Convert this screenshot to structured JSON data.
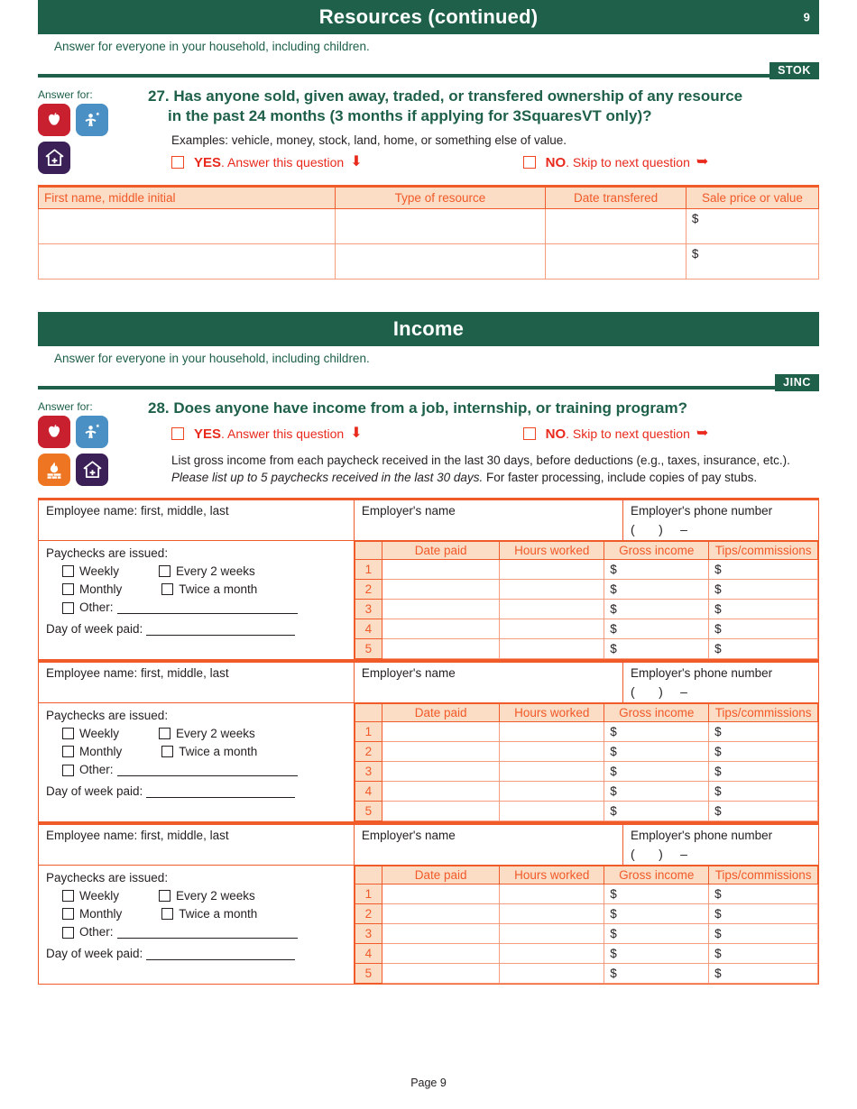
{
  "document": {
    "footer": "Page 9"
  },
  "sections": [
    {
      "banner_title": "Resources (continued)",
      "banner_page": "9",
      "banner_subtitle": "Answer for everyone in your household, including children.",
      "code_badge": "STOK"
    },
    {
      "banner_title": "Income",
      "banner_page": "",
      "banner_subtitle": "Answer for everyone in your household, including children.",
      "code_badge": "JINC"
    }
  ],
  "answer_for_label": "Answer for:",
  "icons": {
    "apple": "apple-icon",
    "child": "child-star-icon",
    "fuel": "fuel-flame-icon",
    "health": "house-health-icon"
  },
  "yesno": {
    "yes_word": "YES",
    "yes_text": ". Answer this question",
    "yes_arrow": "⬇",
    "no_word": "NO",
    "no_text": ". Skip to next question",
    "no_arrow": "➥"
  },
  "q27": {
    "number": "27.",
    "line1": "Has anyone sold, given away, traded, or transfered ownership of any resource",
    "line2": "in the past 24 months (3 months if applying for 3SquaresVT only)?",
    "examples": "Examples: vehicle, money, stock, land, home, or something else of value.",
    "table": {
      "headers": [
        "First name, middle initial",
        "Type of resource",
        "Date transfered",
        "Sale price or value"
      ],
      "rows": [
        [
          "",
          "",
          "",
          "$"
        ],
        [
          "",
          "",
          "",
          "$"
        ]
      ]
    }
  },
  "q28": {
    "number": "28.",
    "title": "Does anyone have income from a job, internship, or training program?",
    "instructions_a": "List gross income from each paycheck received in the last 30 days, before deductions (e.g., taxes, insurance, etc.). ",
    "instructions_italic": "Please list up to 5 paychecks received in the last 30 days.",
    "instructions_b": " For faster processing, include copies of pay stubs.",
    "employer_block": {
      "employee_name_label": "Employee name: first, middle, last",
      "employer_name_label": "Employer's name",
      "employer_phone_label": "Employer's phone number",
      "phone_open": "(",
      "phone_close": ")",
      "phone_dash": "–",
      "paychecks_label": "Paychecks are issued:",
      "options": [
        "Weekly",
        "Every 2 weeks",
        "Monthly",
        "Twice a month",
        "Other:"
      ],
      "day_of_week_label": "Day of week paid:",
      "table_headers": [
        "Date paid",
        "Hours worked",
        "Gross income",
        "Tips/commissions"
      ],
      "row_numbers": [
        "1",
        "2",
        "3",
        "4",
        "5"
      ],
      "currency_symbol": "$"
    },
    "block_count": 3
  },
  "colors": {
    "green": "#1e6049",
    "orange": "#f15a29",
    "red": "#e8291c",
    "peach": "#fbdcc4"
  }
}
